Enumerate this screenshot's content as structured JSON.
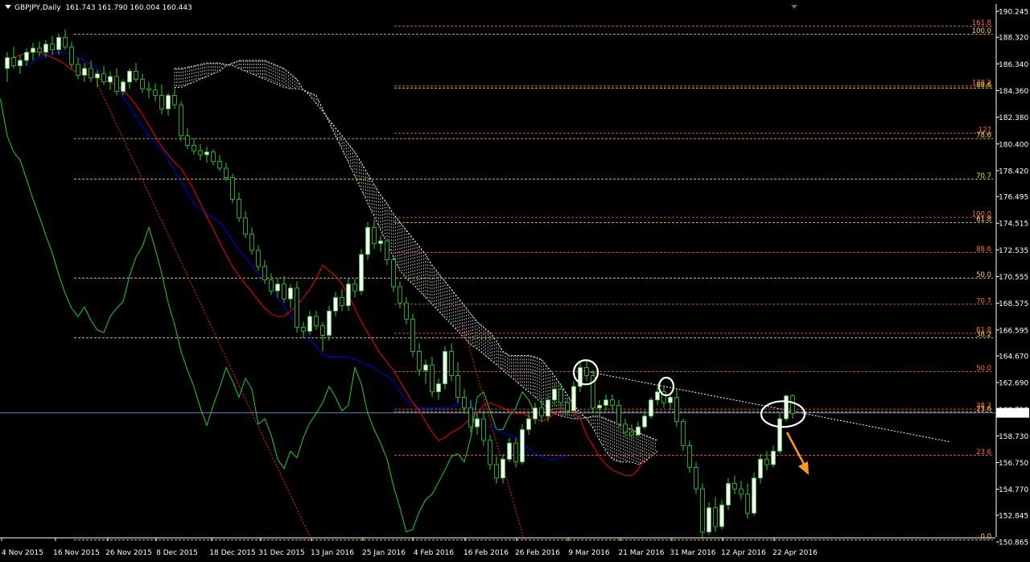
{
  "header": {
    "symbol": "GBPJPY,Daily",
    "ohlc": "161.743 161.790 160.004 160.443"
  },
  "colors": {
    "background": "#000000",
    "bull_candle": "#ffffff",
    "bear_candle": "#000000",
    "wick": "#2fd12f",
    "tenkan": "#ff0000",
    "kijun": "#0000ff",
    "chikou": "#1fd11f",
    "cloud": "#ffffff",
    "fib_orange": "#ff6e2a",
    "fib_yellow": "#ffd54a",
    "trend_red": "#ff2020",
    "price_line": "#6a7fb6",
    "arrow": "#ff9a1f"
  },
  "chart_data": {
    "type": "candlestick",
    "title": "GBPJPY,Daily",
    "current_price": "160.443",
    "y_axis": {
      "ylim": [
        150.4,
        190.5
      ],
      "ticks": [
        "190.245",
        "188.320",
        "186.340",
        "184.360",
        "182.380",
        "180.400",
        "178.420",
        "176.495",
        "174.515",
        "172.535",
        "170.555",
        "168.575",
        "166.595",
        "164.670",
        "162.690",
        "160.710",
        "158.730",
        "156.750",
        "154.770",
        "152.845",
        "150.865"
      ]
    },
    "x_axis": {
      "labels": [
        "4 Nov 2015",
        "16 Nov 2015",
        "26 Nov 2015",
        "8 Dec 2015",
        "18 Dec 2015",
        "31 Dec 2015",
        "13 Jan 2016",
        "25 Jan 2016",
        "4 Feb 2016",
        "16 Feb 2016",
        "26 Feb 2016",
        "9 Mar 2016",
        "21 Mar 2016",
        "31 Mar 2016",
        "12 Apr 2016",
        "22 Apr 2016"
      ]
    },
    "ohlc": [
      [
        186.0,
        187.2,
        185.0,
        186.8
      ],
      [
        186.8,
        187.6,
        186.0,
        186.2
      ],
      [
        186.2,
        187.0,
        185.6,
        186.6
      ],
      [
        186.6,
        187.5,
        186.2,
        187.2
      ],
      [
        187.2,
        187.9,
        186.6,
        187.5
      ],
      [
        187.5,
        188.0,
        186.9,
        187.2
      ],
      [
        187.2,
        188.1,
        186.8,
        187.8
      ],
      [
        187.8,
        188.4,
        187.0,
        187.4
      ],
      [
        187.4,
        188.6,
        187.0,
        188.3
      ],
      [
        188.3,
        188.9,
        187.4,
        187.6
      ],
      [
        187.6,
        188.0,
        186.0,
        186.3
      ],
      [
        186.3,
        186.8,
        185.2,
        185.5
      ],
      [
        185.5,
        186.4,
        185.0,
        186.0
      ],
      [
        186.0,
        186.6,
        185.0,
        185.3
      ],
      [
        185.3,
        185.9,
        184.6,
        185.6
      ],
      [
        185.6,
        186.2,
        184.8,
        185.0
      ],
      [
        185.0,
        185.8,
        184.4,
        185.4
      ],
      [
        185.4,
        186.0,
        184.0,
        184.3
      ],
      [
        184.3,
        185.2,
        184.0,
        185.0
      ],
      [
        185.0,
        186.0,
        184.5,
        185.8
      ],
      [
        185.8,
        186.4,
        185.0,
        185.2
      ],
      [
        185.2,
        185.6,
        184.2,
        184.5
      ],
      [
        184.5,
        185.0,
        183.8,
        184.4
      ],
      [
        184.4,
        184.9,
        183.6,
        184.0
      ],
      [
        184.0,
        184.8,
        182.6,
        183.0
      ],
      [
        183.0,
        184.2,
        182.5,
        184.0
      ],
      [
        184.0,
        184.6,
        183.0,
        183.3
      ],
      [
        183.3,
        183.6,
        180.6,
        181.0
      ],
      [
        181.0,
        181.6,
        180.0,
        180.3
      ],
      [
        180.3,
        180.8,
        179.6,
        179.9
      ],
      [
        179.9,
        180.4,
        179.2,
        179.6
      ],
      [
        179.6,
        180.2,
        179.0,
        179.8
      ],
      [
        179.8,
        180.0,
        178.8,
        179.1
      ],
      [
        179.1,
        179.6,
        178.4,
        178.6
      ],
      [
        178.6,
        179.0,
        177.6,
        177.9
      ],
      [
        177.9,
        178.2,
        176.0,
        176.3
      ],
      [
        176.3,
        176.8,
        174.6,
        174.9
      ],
      [
        174.9,
        175.4,
        173.4,
        173.7
      ],
      [
        173.7,
        174.2,
        172.2,
        172.5
      ],
      [
        172.5,
        172.9,
        171.0,
        171.3
      ],
      [
        171.3,
        171.8,
        170.0,
        170.3
      ],
      [
        170.3,
        170.8,
        169.2,
        169.5
      ],
      [
        169.5,
        170.4,
        169.0,
        170.0
      ],
      [
        170.0,
        170.6,
        168.6,
        168.9
      ],
      [
        168.9,
        170.0,
        168.2,
        169.7
      ],
      [
        169.7,
        170.2,
        166.4,
        166.8
      ],
      [
        166.8,
        167.2,
        166.0,
        166.5
      ],
      [
        166.5,
        168.0,
        166.2,
        167.6
      ],
      [
        167.6,
        168.0,
        166.6,
        166.9
      ],
      [
        166.9,
        167.2,
        165.0,
        166.2
      ],
      [
        166.2,
        168.4,
        165.8,
        168.0
      ],
      [
        168.0,
        169.4,
        167.6,
        169.0
      ],
      [
        169.0,
        169.6,
        168.0,
        168.4
      ],
      [
        168.4,
        170.4,
        168.0,
        170.0
      ],
      [
        170.0,
        170.4,
        169.0,
        169.5
      ],
      [
        169.5,
        172.6,
        169.2,
        172.2
      ],
      [
        172.2,
        174.6,
        171.8,
        174.2
      ],
      [
        174.2,
        174.8,
        172.6,
        173.0
      ],
      [
        173.0,
        173.6,
        172.4,
        173.2
      ],
      [
        173.2,
        173.4,
        171.4,
        171.8
      ],
      [
        171.8,
        172.0,
        169.4,
        169.8
      ],
      [
        169.8,
        170.2,
        168.2,
        168.6
      ],
      [
        168.6,
        169.0,
        167.0,
        167.4
      ],
      [
        167.4,
        167.8,
        164.6,
        165.0
      ],
      [
        165.0,
        165.6,
        163.2,
        163.6
      ],
      [
        163.6,
        164.4,
        162.6,
        164.0
      ],
      [
        164.0,
        164.6,
        161.6,
        162.0
      ],
      [
        162.0,
        163.0,
        161.4,
        162.6
      ],
      [
        162.6,
        165.4,
        162.2,
        165.0
      ],
      [
        165.0,
        165.6,
        162.8,
        163.2
      ],
      [
        163.2,
        164.2,
        161.2,
        161.6
      ],
      [
        161.6,
        162.2,
        160.4,
        160.8
      ],
      [
        160.8,
        161.4,
        159.0,
        159.4
      ],
      [
        159.4,
        160.4,
        158.8,
        160.0
      ],
      [
        160.0,
        160.6,
        158.0,
        158.4
      ],
      [
        158.4,
        158.8,
        156.2,
        156.6
      ],
      [
        156.6,
        157.2,
        155.2,
        155.6
      ],
      [
        155.6,
        157.4,
        155.2,
        157.0
      ],
      [
        157.0,
        158.6,
        156.8,
        158.2
      ],
      [
        158.2,
        158.6,
        156.4,
        156.8
      ],
      [
        156.8,
        159.6,
        156.6,
        159.2
      ],
      [
        159.2,
        160.4,
        158.8,
        160.0
      ],
      [
        160.0,
        161.2,
        159.6,
        160.8
      ],
      [
        160.8,
        161.6,
        159.8,
        160.2
      ],
      [
        160.2,
        161.8,
        159.8,
        161.4
      ],
      [
        161.4,
        162.6,
        161.0,
        162.2
      ],
      [
        162.2,
        162.6,
        160.8,
        161.2
      ],
      [
        161.2,
        161.6,
        160.2,
        160.6
      ],
      [
        160.6,
        162.8,
        160.4,
        162.4
      ],
      [
        162.4,
        164.2,
        162.0,
        163.8
      ],
      [
        163.8,
        164.4,
        162.8,
        163.2
      ],
      [
        163.2,
        163.6,
        160.4,
        160.8
      ],
      [
        160.8,
        161.4,
        160.0,
        161.0
      ],
      [
        161.0,
        161.8,
        160.6,
        161.4
      ],
      [
        161.4,
        161.8,
        160.6,
        161.0
      ],
      [
        161.0,
        161.4,
        159.2,
        159.6
      ],
      [
        159.6,
        160.0,
        158.6,
        159.0
      ],
      [
        159.0,
        159.6,
        158.4,
        158.8
      ],
      [
        158.8,
        159.8,
        158.6,
        159.4
      ],
      [
        159.4,
        160.6,
        159.2,
        160.2
      ],
      [
        160.2,
        161.6,
        160.0,
        161.4
      ],
      [
        161.4,
        162.4,
        161.0,
        162.0
      ],
      [
        162.0,
        162.4,
        160.8,
        161.2
      ],
      [
        161.2,
        161.8,
        160.6,
        161.6
      ],
      [
        161.6,
        162.2,
        159.4,
        159.8
      ],
      [
        159.8,
        160.0,
        157.6,
        158.0
      ],
      [
        158.0,
        158.4,
        156.0,
        156.4
      ],
      [
        156.4,
        156.8,
        154.4,
        154.8
      ],
      [
        154.8,
        155.2,
        151.2,
        151.6
      ],
      [
        151.6,
        153.8,
        151.4,
        153.4
      ],
      [
        153.4,
        154.2,
        151.6,
        152.0
      ],
      [
        152.0,
        154.0,
        151.8,
        153.6
      ],
      [
        153.6,
        155.6,
        153.2,
        155.2
      ],
      [
        155.2,
        155.8,
        154.4,
        154.8
      ],
      [
        154.8,
        155.4,
        154.0,
        154.4
      ],
      [
        154.4,
        155.2,
        152.6,
        153.0
      ],
      [
        153.0,
        156.0,
        152.8,
        155.6
      ],
      [
        155.6,
        157.4,
        155.2,
        157.0
      ],
      [
        157.0,
        157.6,
        156.2,
        156.6
      ],
      [
        156.6,
        158.0,
        156.4,
        157.6
      ],
      [
        157.6,
        160.4,
        157.4,
        160.0
      ],
      [
        160.0,
        161.8,
        159.8,
        161.7
      ],
      [
        161.7,
        161.8,
        160.0,
        160.4
      ]
    ],
    "tenkan_sen": [
      186.6,
      186.8,
      187.0,
      187.1,
      187.3,
      187.2,
      187.0,
      186.8,
      186.6,
      186.3,
      185.9,
      185.7,
      185.6,
      185.5,
      185.3,
      185.1,
      185.0,
      184.7,
      184.4,
      183.9,
      183.3,
      182.6,
      181.8,
      181.0,
      180.2,
      179.6,
      179.0,
      178.6,
      177.8,
      177.0,
      176.0,
      175.0,
      174.1,
      173.1,
      172.2,
      171.3,
      170.6,
      170.0,
      169.4,
      168.8,
      168.2,
      167.8,
      167.6,
      167.6,
      168.0,
      168.4,
      169.0,
      169.6,
      170.4,
      171.4,
      171.0,
      170.6,
      170.0,
      169.2,
      168.2,
      167.2,
      166.4,
      165.6,
      164.8,
      164.2,
      163.6,
      162.8,
      162.0,
      161.2,
      160.6,
      159.8,
      159.0,
      158.4,
      158.6,
      159.0,
      159.2,
      159.6,
      160.0,
      160.4,
      161.0,
      161.2,
      161.0,
      160.8,
      160.6,
      160.4,
      160.4,
      160.2,
      160.0,
      159.8,
      160.0,
      160.4,
      160.6,
      160.8,
      160.4,
      160.0,
      158.8,
      158.0,
      157.2,
      156.6,
      156.2,
      156.0,
      155.8,
      155.8,
      156.2,
      157.0
    ],
    "kijun_sen": [
      186.2,
      186.3,
      186.5,
      186.8,
      187.0,
      187.1,
      187.2,
      187.2,
      187.0,
      186.8,
      186.6,
      186.3,
      186.0,
      185.6,
      185.1,
      184.6,
      183.9,
      183.2,
      182.4,
      181.7,
      181.0,
      180.5,
      180.0,
      179.2,
      178.4,
      177.6,
      176.8,
      176.0,
      175.6,
      175.2,
      174.9,
      174.6,
      174.0,
      173.2,
      172.5,
      172.0,
      171.4,
      170.8,
      170.4,
      169.8,
      169.0,
      168.4,
      167.6,
      167.0,
      166.4,
      165.8,
      165.4,
      164.8,
      164.6,
      164.6,
      164.6,
      164.6,
      164.4,
      164.2,
      164.0,
      163.8,
      163.4,
      163.2,
      162.8,
      162.0,
      161.4,
      161.0,
      160.8,
      160.8,
      160.8,
      160.8,
      160.8,
      160.8,
      161.2,
      161.2,
      161.2,
      160.2,
      159.6,
      159.4,
      159.2,
      159.0,
      158.8,
      158.6,
      158.2,
      157.8,
      157.4,
      157.2,
      157.0,
      157.0,
      157.1,
      157.2
    ],
    "chikou": [
      184.5,
      183.6,
      181.0,
      179.8,
      179.2,
      177.8,
      176.3,
      175.0,
      173.6,
      172.3,
      170.7,
      169.3,
      168.2,
      167.6,
      168.3,
      167.3,
      166.6,
      166.4,
      167.6,
      168.2,
      168.7,
      170.6,
      172.0,
      172.8,
      174.2,
      172.6,
      170.8,
      168.6,
      167.0,
      165.0,
      163.6,
      162.4,
      160.8,
      159.5,
      161.0,
      162.3,
      163.8,
      162.8,
      161.6,
      163.0,
      162.2,
      159.6,
      160.0,
      158.8,
      157.0,
      156.3,
      157.6,
      157.1,
      158.6,
      159.7,
      160.4,
      161.2,
      162.4,
      161.6,
      160.6,
      161.0,
      163.8,
      162.6,
      160.4,
      159.2,
      158.2,
      157.0,
      155.0,
      153.4,
      151.6,
      151.8,
      153.1,
      154.0,
      154.4,
      155.3,
      156.2,
      157.2,
      157.4,
      156.8,
      158.6,
      161.6,
      162.0,
      160.6,
      159.2,
      159.2,
      160.2,
      160.8,
      162.0,
      161.4,
      160.4
    ],
    "cloud_a": [
      186.0,
      186.0,
      186.1,
      186.2,
      186.3,
      186.4,
      186.4,
      186.4,
      186.3,
      186.2,
      186.0,
      185.8,
      185.6,
      185.4,
      185.2,
      185.0,
      184.8,
      184.6,
      184.5,
      184.5,
      184.4,
      184.2,
      184.0,
      183.0,
      182.0,
      181.0,
      180.0,
      179.0,
      178.0,
      177.0,
      176.0,
      175.0,
      174.0,
      173.0,
      172.0,
      171.0,
      170.4,
      170.0,
      169.5,
      169.0,
      168.5,
      168.0,
      167.5,
      167.0,
      166.5,
      166.0,
      165.5,
      165.2,
      164.8,
      164.4,
      164.0,
      163.6,
      163.2,
      162.8,
      162.4,
      162.0,
      161.6,
      161.2,
      160.8,
      160.4,
      160.2,
      160.1,
      160.0,
      160.0,
      160.1,
      160.2,
      160.2,
      160.0,
      159.8,
      159.6,
      159.4,
      159.2,
      159.0,
      158.8,
      158.6,
      158.4
    ],
    "cloud_b": [
      184.6,
      184.6,
      184.8,
      185.0,
      185.2,
      185.4,
      185.6,
      185.8,
      186.2,
      186.4,
      186.6,
      186.6,
      186.6,
      186.6,
      186.6,
      186.4,
      186.2,
      186.0,
      185.6,
      185.2,
      184.4,
      184.0,
      183.4,
      182.8,
      182.2,
      181.6,
      181.0,
      180.4,
      179.8,
      179.0,
      178.2,
      177.4,
      176.6,
      176.0,
      175.2,
      174.6,
      174.0,
      173.4,
      172.8,
      172.2,
      171.4,
      170.8,
      170.2,
      169.6,
      169.0,
      168.4,
      167.8,
      167.2,
      166.8,
      166.4,
      165.8,
      165.0,
      164.7,
      164.7,
      164.7,
      164.7,
      164.6,
      164.4,
      163.8,
      163.2,
      162.5,
      161.8,
      161.0,
      160.5,
      160.0,
      159.3,
      158.4,
      157.6,
      157.0,
      156.8,
      156.8,
      156.8,
      156.6,
      156.8,
      157.2,
      157.6
    ],
    "fibonacci_levels": [
      {
        "label": "161.8",
        "price": 189.15,
        "color": "#ff6e2a"
      },
      {
        "label": "100.0",
        "price": 188.55,
        "color": "#ffd54a"
      },
      {
        "label": "138.2",
        "price": 184.7,
        "color": "#ff6e2a"
      },
      {
        "label": "88.6",
        "price": 184.55,
        "color": "#ffd54a"
      },
      {
        "label": "127",
        "price": 181.2,
        "color": "#ff6e2a"
      },
      {
        "label": "78.6",
        "price": 180.8,
        "color": "#ffd54a"
      },
      {
        "label": "70.7",
        "price": 177.8,
        "color": "#ffd54a"
      },
      {
        "label": "100.0",
        "price": 174.95,
        "color": "#ff6e2a"
      },
      {
        "label": "61.8",
        "price": 174.55,
        "color": "#ffd54a"
      },
      {
        "label": "88.6",
        "price": 172.35,
        "color": "#ff6e2a"
      },
      {
        "label": "50.0",
        "price": 170.45,
        "color": "#ffd54a"
      },
      {
        "label": "70.7",
        "price": 168.5,
        "color": "#ff6e2a"
      },
      {
        "label": "61.8",
        "price": 166.35,
        "color": "#ff6e2a"
      },
      {
        "label": "38.2",
        "price": 166.0,
        "color": "#ffd54a"
      },
      {
        "label": "50.0",
        "price": 163.5,
        "color": "#ff6e2a"
      },
      {
        "label": "38.2",
        "price": 160.72,
        "color": "#ff6e2a"
      },
      {
        "label": "23.6",
        "price": 160.5,
        "color": "#ffd54a"
      },
      {
        "label": "23.6",
        "price": 157.3,
        "color": "#ff6e2a"
      },
      {
        "label": "0.0",
        "price": 151.0,
        "color": "#ffd54a"
      }
    ],
    "grid": false,
    "legend": "none"
  }
}
